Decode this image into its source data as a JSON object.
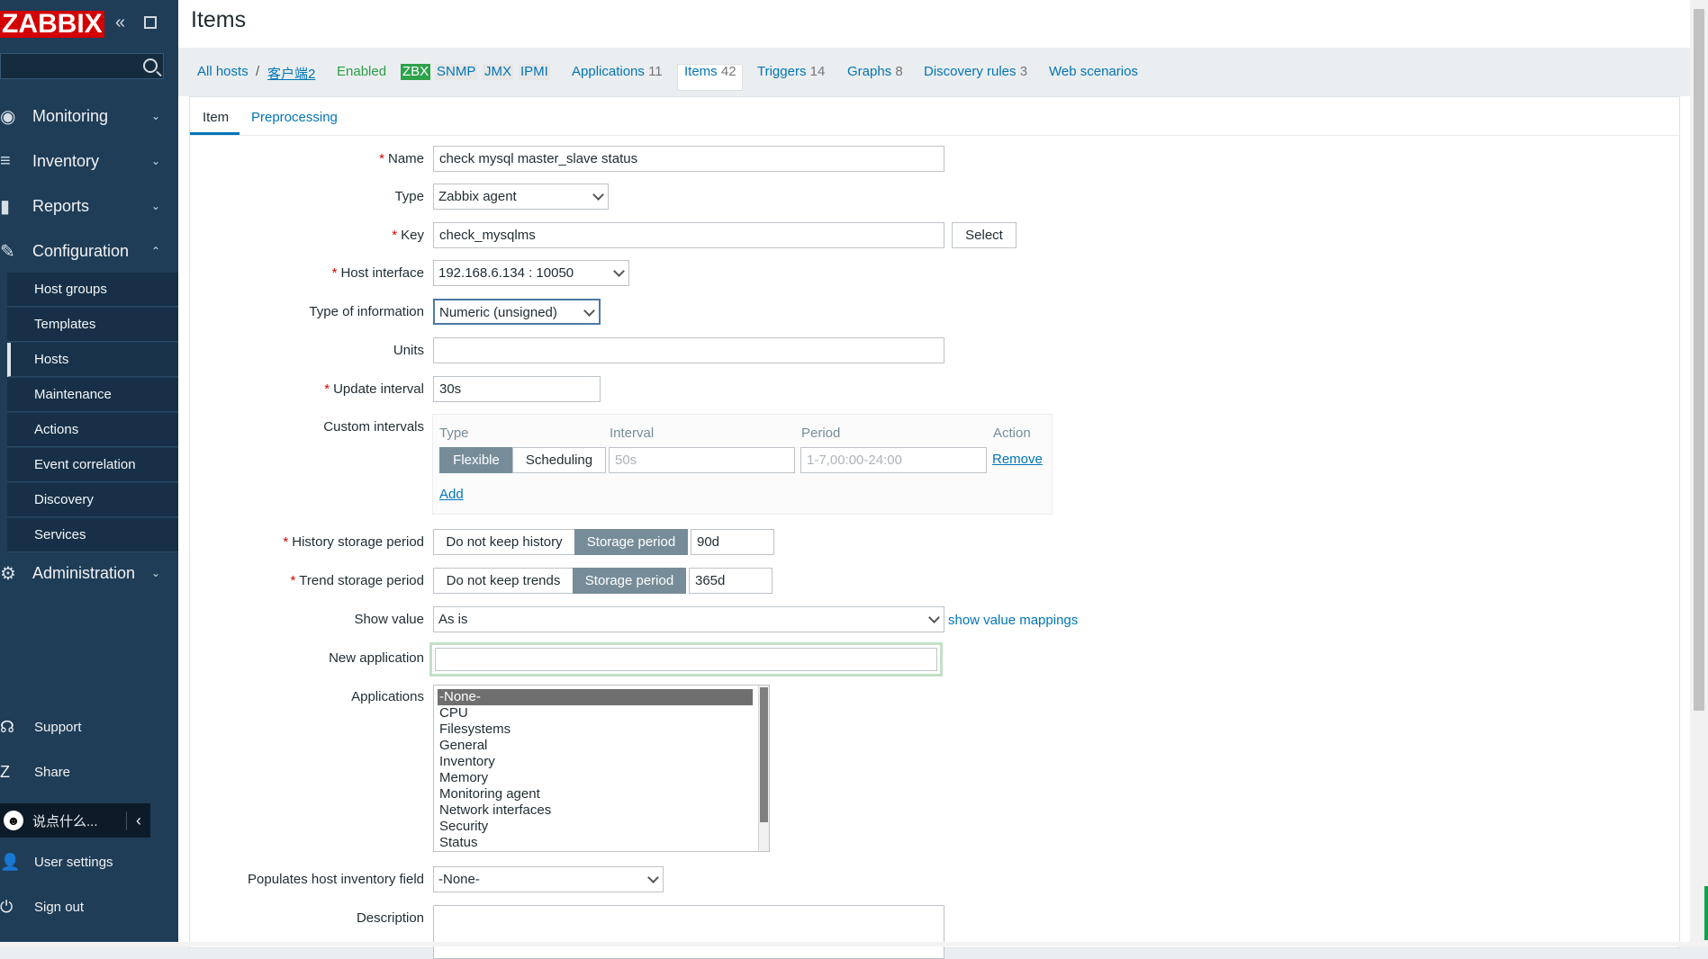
{
  "sidebar": {
    "logo": "ZABBIX",
    "collapse_glyph": "«",
    "menu": [
      {
        "label": "Monitoring",
        "icon": "eye-icon",
        "glyph": "◉"
      },
      {
        "label": "Inventory",
        "icon": "list-icon",
        "glyph": "≡"
      },
      {
        "label": "Reports",
        "icon": "bar-chart-icon",
        "glyph": "▮"
      },
      {
        "label": "Configuration",
        "icon": "wrench-icon",
        "glyph": "✎"
      },
      {
        "label": "Administration",
        "icon": "gear-icon",
        "glyph": "⚙"
      }
    ],
    "config_items": [
      "Host groups",
      "Templates",
      "Hosts",
      "Maintenance",
      "Actions",
      "Event correlation",
      "Discovery",
      "Services"
    ],
    "footer": [
      {
        "label": "Support",
        "glyph": "☊"
      },
      {
        "label": "Share",
        "glyph": "Z"
      },
      {
        "label": "User settings",
        "glyph": "👤"
      },
      {
        "label": "Sign out",
        "glyph": "⏻"
      }
    ],
    "ime_text": "说点什么..."
  },
  "page": {
    "title": "Items"
  },
  "breadcrumb": {
    "all_hosts": "All hosts",
    "separator": "/",
    "host": "客户端2",
    "status": "Enabled",
    "badges": [
      "ZBX",
      "SNMP",
      "JMX",
      "IPMI"
    ],
    "links": [
      {
        "label": "Applications",
        "count": "11"
      },
      {
        "label": "Items",
        "count": "42"
      },
      {
        "label": "Triggers",
        "count": "14"
      },
      {
        "label": "Graphs",
        "count": "8"
      },
      {
        "label": "Discovery rules",
        "count": "3"
      },
      {
        "label": "Web scenarios",
        "count": ""
      }
    ]
  },
  "tabs": {
    "item": "Item",
    "preprocessing": "Preprocessing"
  },
  "form": {
    "name_label": "Name",
    "name_value": "check mysql master_slave status",
    "type_label": "Type",
    "type_value": "Zabbix agent",
    "key_label": "Key",
    "key_value": "check_mysqlms",
    "select_button": "Select",
    "host_interface_label": "Host interface",
    "host_interface_value": "192.168.6.134 : 10050",
    "type_info_label": "Type of information",
    "type_info_value": "Numeric (unsigned)",
    "units_label": "Units",
    "units_value": "",
    "update_interval_label": "Update interval",
    "update_interval_value": "30s",
    "custom_intervals_label": "Custom intervals",
    "custom_intervals": {
      "headers": {
        "type": "Type",
        "interval": "Interval",
        "period": "Period",
        "action": "Action"
      },
      "flexible": "Flexible",
      "scheduling": "Scheduling",
      "interval_placeholder": "50s",
      "period_placeholder": "1-7,00:00-24:00",
      "remove": "Remove",
      "add": "Add"
    },
    "history_label": "History storage period",
    "history_no_keep": "Do not keep history",
    "history_storage": "Storage period",
    "history_value": "90d",
    "trend_label": "Trend storage period",
    "trend_no_keep": "Do not keep trends",
    "trend_storage": "Storage period",
    "trend_value": "365d",
    "show_value_label": "Show value",
    "show_value_value": "As is",
    "show_value_mappings": "show value mappings",
    "new_application_label": "New application",
    "applications_label": "Applications",
    "applications": [
      "-None-",
      "CPU",
      "Filesystems",
      "General",
      "Inventory",
      "Memory",
      "Monitoring agent",
      "Network interfaces",
      "Security",
      "Status"
    ],
    "inventory_label": "Populates host inventory field",
    "inventory_value": "-None-",
    "description_label": "Description"
  },
  "colors": {
    "sidebar": "#1f3d57",
    "logo": "#d40000",
    "link": "#0275b8",
    "enabled": "#2da24a",
    "active_segment": "#768d99"
  }
}
